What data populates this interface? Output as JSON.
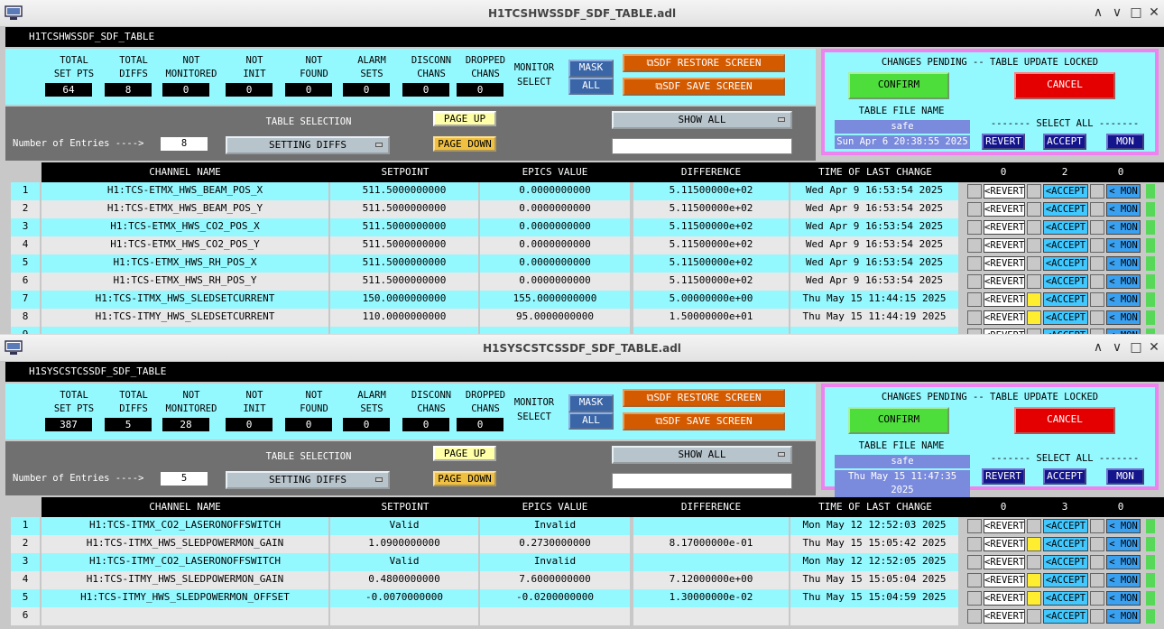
{
  "window1": {
    "title": "H1TCSHWSSDF_SDF_TABLE.adl",
    "header": "H1TCSHWSSDF_SDF_TABLE",
    "stats": [
      {
        "l1": "TOTAL",
        "l2": "SET PTS",
        "value": "64"
      },
      {
        "l1": "TOTAL",
        "l2": "DIFFS",
        "value": "8"
      },
      {
        "l1": "NOT",
        "l2": "MONITORED",
        "value": "0"
      },
      {
        "l1": "NOT",
        "l2": "INIT",
        "value": "0"
      },
      {
        "l1": "NOT",
        "l2": "FOUND",
        "value": "0"
      },
      {
        "l1": "ALARM",
        "l2": "SETS",
        "value": "0"
      },
      {
        "l1": "DISCONN",
        "l2": "CHANS",
        "value": "0"
      },
      {
        "l1": "DROPPED",
        "l2": "CHANS",
        "value": "0"
      }
    ],
    "monitor_select": [
      "MONITOR",
      "SELECT"
    ],
    "mask_label": "MASK",
    "all_label": "ALL",
    "restore_label": "SDF RESTORE SCREEN",
    "save_label": "SDF SAVE SCREEN",
    "changes_pending": "CHANGES PENDING -- TABLE UPDATE LOCKED",
    "confirm": "CONFIRM",
    "cancel": "CANCEL",
    "table_file_name_label": "TABLE FILE NAME",
    "table_file_name": "safe",
    "file_time": "Sun Apr  6 20:38:55 2025",
    "select_all": "------- SELECT ALL -------",
    "revert_all": "REVERT",
    "accept_all": "ACCEPT",
    "mon_all": "MON",
    "table_selection_label": "TABLE SELECTION",
    "page_up": "PAGE UP",
    "page_down": "PAGE DOWN",
    "show_all": "SHOW ALL",
    "num_entries_label": "Number of Entries ---->",
    "num_entries": "8",
    "table_selection": "SETTING DIFFS",
    "columns": {
      "channel": "CHANNEL NAME",
      "setpoint": "SETPOINT",
      "epics": "EPICS VALUE",
      "difference": "DIFFERENCE",
      "time": "TIME OF LAST CHANGE",
      "c1": "0",
      "c2": "2",
      "c3": "0"
    },
    "rows": [
      {
        "n": "1",
        "channel": "H1:TCS-ETMX_HWS_BEAM_POS_X",
        "setpoint": "511.5000000000",
        "epics": "0.0000000000",
        "diff": "5.11500000e+02",
        "time": "Wed Apr  9 16:53:54 2025",
        "flag": false
      },
      {
        "n": "2",
        "channel": "H1:TCS-ETMX_HWS_BEAM_POS_Y",
        "setpoint": "511.5000000000",
        "epics": "0.0000000000",
        "diff": "5.11500000e+02",
        "time": "Wed Apr  9 16:53:54 2025",
        "flag": false
      },
      {
        "n": "3",
        "channel": "H1:TCS-ETMX_HWS_CO2_POS_X",
        "setpoint": "511.5000000000",
        "epics": "0.0000000000",
        "diff": "5.11500000e+02",
        "time": "Wed Apr  9 16:53:54 2025",
        "flag": false
      },
      {
        "n": "4",
        "channel": "H1:TCS-ETMX_HWS_CO2_POS_Y",
        "setpoint": "511.5000000000",
        "epics": "0.0000000000",
        "diff": "5.11500000e+02",
        "time": "Wed Apr  9 16:53:54 2025",
        "flag": false
      },
      {
        "n": "5",
        "channel": "H1:TCS-ETMX_HWS_RH_POS_X",
        "setpoint": "511.5000000000",
        "epics": "0.0000000000",
        "diff": "5.11500000e+02",
        "time": "Wed Apr  9 16:53:54 2025",
        "flag": false
      },
      {
        "n": "6",
        "channel": "H1:TCS-ETMX_HWS_RH_POS_Y",
        "setpoint": "511.5000000000",
        "epics": "0.0000000000",
        "diff": "5.11500000e+02",
        "time": "Wed Apr  9 16:53:54 2025",
        "flag": false
      },
      {
        "n": "7",
        "channel": "H1:TCS-ITMX_HWS_SLEDSETCURRENT",
        "setpoint": "150.0000000000",
        "epics": "155.0000000000",
        "diff": "5.00000000e+00",
        "time": "Thu May 15 11:44:15 2025",
        "flag": true
      },
      {
        "n": "8",
        "channel": "H1:TCS-ITMY_HWS_SLEDSETCURRENT",
        "setpoint": "110.0000000000",
        "epics": "95.0000000000",
        "diff": "1.50000000e+01",
        "time": "Thu May 15 11:44:19 2025",
        "flag": true
      },
      {
        "n": "9",
        "channel": "",
        "setpoint": "",
        "epics": "",
        "diff": "",
        "time": "",
        "flag": false
      }
    ]
  },
  "window2": {
    "title": "H1SYSCSTCSSDF_SDF_TABLE.adl",
    "header": "H1SYSCSTCSSDF_SDF_TABLE",
    "stats": [
      {
        "l1": "TOTAL",
        "l2": "SET PTS",
        "value": "387"
      },
      {
        "l1": "TOTAL",
        "l2": "DIFFS",
        "value": "5"
      },
      {
        "l1": "NOT",
        "l2": "MONITORED",
        "value": "28"
      },
      {
        "l1": "NOT",
        "l2": "INIT",
        "value": "0"
      },
      {
        "l1": "NOT",
        "l2": "FOUND",
        "value": "0"
      },
      {
        "l1": "ALARM",
        "l2": "SETS",
        "value": "0"
      },
      {
        "l1": "DISCONN",
        "l2": "CHANS",
        "value": "0"
      },
      {
        "l1": "DROPPED",
        "l2": "CHANS",
        "value": "0"
      }
    ],
    "monitor_select": [
      "MONITOR",
      "SELECT"
    ],
    "mask_label": "MASK",
    "all_label": "ALL",
    "restore_label": "SDF RESTORE SCREEN",
    "save_label": "SDF SAVE SCREEN",
    "changes_pending": "CHANGES PENDING -- TABLE UPDATE LOCKED",
    "confirm": "CONFIRM",
    "cancel": "CANCEL",
    "table_file_name_label": "TABLE FILE NAME",
    "table_file_name": "safe",
    "file_time": "Thu May 15 11:47:35 2025",
    "select_all": "------- SELECT ALL -------",
    "revert_all": "REVERT",
    "accept_all": "ACCEPT",
    "mon_all": "MON",
    "table_selection_label": "TABLE SELECTION",
    "page_up": "PAGE UP",
    "page_down": "PAGE DOWN",
    "show_all": "SHOW ALL",
    "num_entries_label": "Number of Entries ---->",
    "num_entries": "5",
    "table_selection": "SETTING DIFFS",
    "columns": {
      "channel": "CHANNEL NAME",
      "setpoint": "SETPOINT",
      "epics": "EPICS VALUE",
      "difference": "DIFFERENCE",
      "time": "TIME OF LAST CHANGE",
      "c1": "0",
      "c2": "3",
      "c3": "0"
    },
    "rows": [
      {
        "n": "1",
        "channel": "H1:TCS-ITMX_CO2_LASERONOFFSWITCH",
        "setpoint": "Valid",
        "epics": "Invalid",
        "diff": "",
        "time": "Mon May 12 12:52:03 2025",
        "flag": false
      },
      {
        "n": "2",
        "channel": "H1:TCS-ITMX_HWS_SLEDPOWERMON_GAIN",
        "setpoint": "1.0900000000",
        "epics": "0.2730000000",
        "diff": "8.17000000e-01",
        "time": "Thu May 15 15:05:42 2025",
        "flag": true
      },
      {
        "n": "3",
        "channel": "H1:TCS-ITMY_CO2_LASERONOFFSWITCH",
        "setpoint": "Valid",
        "epics": "Invalid",
        "diff": "",
        "time": "Mon May 12 12:52:05 2025",
        "flag": false
      },
      {
        "n": "4",
        "channel": "H1:TCS-ITMY_HWS_SLEDPOWERMON_GAIN",
        "setpoint": "0.4800000000",
        "epics": "7.6000000000",
        "diff": "7.12000000e+00",
        "time": "Thu May 15 15:05:04 2025",
        "flag": true
      },
      {
        "n": "5",
        "channel": "H1:TCS-ITMY_HWS_SLEDPOWERMON_OFFSET",
        "setpoint": "-0.0070000000",
        "epics": "-0.0200000000",
        "diff": "1.30000000e-02",
        "time": "Thu May 15 15:04:59 2025",
        "flag": true
      },
      {
        "n": "6",
        "channel": "",
        "setpoint": "",
        "epics": "",
        "diff": "",
        "time": "",
        "flag": false
      }
    ]
  },
  "row_buttons": {
    "revert": "<REVERT",
    "accept": "<ACCEPT",
    "mon": "< MON"
  }
}
